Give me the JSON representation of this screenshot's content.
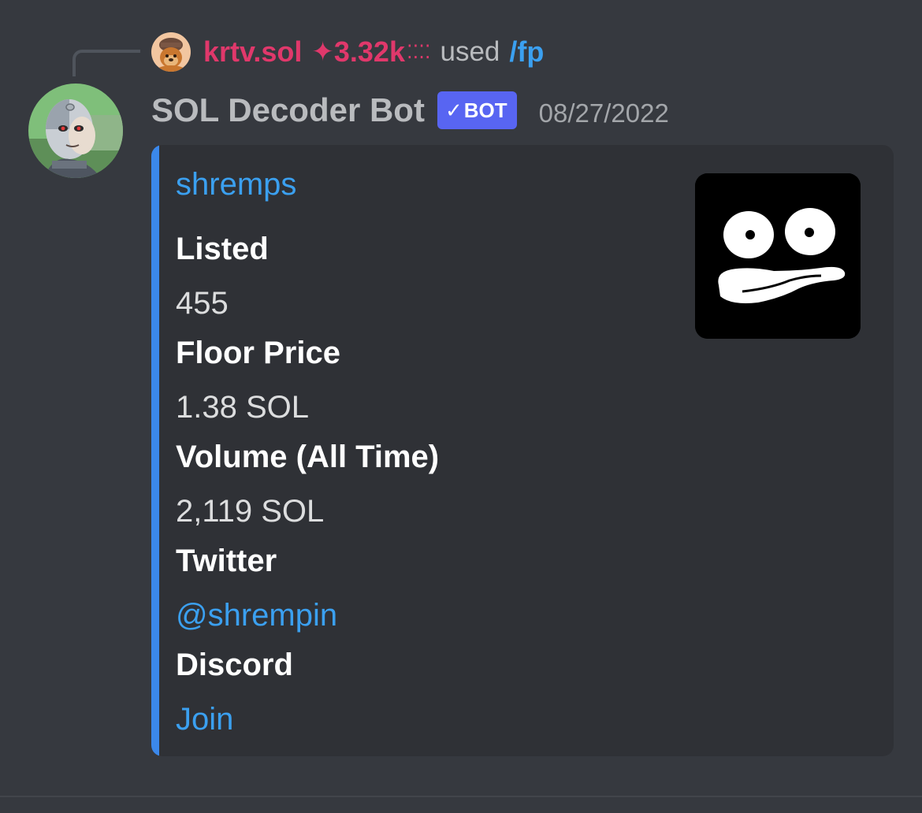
{
  "reply": {
    "username": "krtv.sol",
    "sparkle": "✦",
    "xp": "3.32k",
    "dots": "⁚⁚⁚⁚",
    "used_text": "used",
    "command": "/fp"
  },
  "message": {
    "author": "SOL Decoder Bot",
    "bot_tag_check": "✓",
    "bot_tag": "BOT",
    "timestamp": "08/27/2022"
  },
  "embed": {
    "title": "shremps",
    "accent_color": "#3b88eb",
    "fields": [
      {
        "name": "Listed",
        "value": "455"
      },
      {
        "name": "Floor Price",
        "value": "1.38 SOL"
      },
      {
        "name": "Volume (All Time)",
        "value": "2,119 SOL"
      },
      {
        "name": "Twitter",
        "value": "@shrempin"
      },
      {
        "name": "Discord",
        "value": "Join"
      }
    ],
    "thumbnail_icon": "cartoon-face-icon"
  },
  "colors": {
    "background": "#36393f",
    "embed_background": "#2f3136",
    "link": "#3ba0f0",
    "reply_user": "#e0386b",
    "bot_tag": "#5865f2"
  }
}
